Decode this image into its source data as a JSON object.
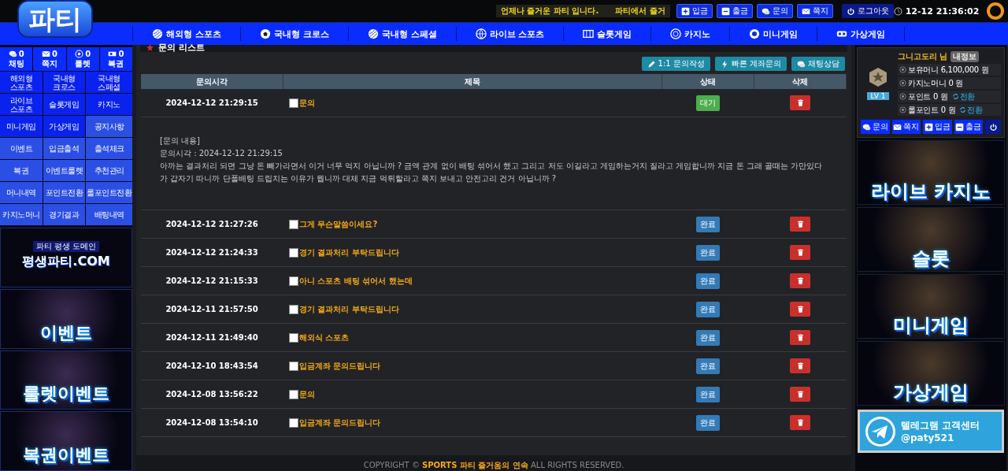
{
  "header": {
    "logo": "파티",
    "marquee": "언제나 즐거운 파티 입니다.      파티에서 즐거",
    "buttons": [
      {
        "label": "입금"
      },
      {
        "label": "출금"
      },
      {
        "label": "문의"
      },
      {
        "label": "쪽지"
      },
      {
        "label": "로그아웃"
      }
    ],
    "clock": "12-12 21:36:02"
  },
  "nav": [
    {
      "label": "해외형 스포츠"
    },
    {
      "label": "국내형 크로스"
    },
    {
      "label": "국내형 스페셜"
    },
    {
      "label": "라이브 스포츠"
    },
    {
      "label": "슬롯게임"
    },
    {
      "label": "카지노"
    },
    {
      "label": "미니게임"
    },
    {
      "label": "가상게임"
    }
  ],
  "sidebar": {
    "counters": [
      {
        "count": "0",
        "label": "채팅"
      },
      {
        "count": "0",
        "label": "쪽지"
      },
      {
        "count": "0",
        "label": "룰렛"
      },
      {
        "count": "0",
        "label": "복권"
      }
    ],
    "menu": [
      {
        "label": "해외형 스포츠",
        "kind": "game"
      },
      {
        "label": "국내형 크로스",
        "kind": "game"
      },
      {
        "label": "국내형 스페셜",
        "kind": "game"
      },
      {
        "label": "라이브 스포츠",
        "kind": "game"
      },
      {
        "label": "슬롯게임",
        "kind": "game"
      },
      {
        "label": "카지노",
        "kind": "game"
      },
      {
        "label": "미니게임",
        "kind": "game"
      },
      {
        "label": "가상게임",
        "kind": "game"
      },
      {
        "label": "공지사항",
        "kind": "info"
      },
      {
        "label": "이벤트",
        "kind": "info"
      },
      {
        "label": "입금출석",
        "kind": "info"
      },
      {
        "label": "출석체크",
        "kind": "info"
      },
      {
        "label": "복권",
        "kind": "info"
      },
      {
        "label": "이벤트룰렛",
        "kind": "info"
      },
      {
        "label": "추천관리",
        "kind": "info"
      },
      {
        "label": "머니내역",
        "kind": "info"
      },
      {
        "label": "포인트전환",
        "kind": "info"
      },
      {
        "label": "롤포인트전환",
        "kind": "info"
      },
      {
        "label": "카지노머니",
        "kind": "info"
      },
      {
        "label": "경기결과",
        "kind": "info"
      },
      {
        "label": "배팅내역",
        "kind": "info"
      }
    ],
    "banners": [
      {
        "kind": "domain",
        "caption": "파티 평생 도메인",
        "title": "평생파티.COM"
      },
      {
        "kind": "promo",
        "title": "이벤트"
      },
      {
        "kind": "promo",
        "title": "룰렛이벤트"
      },
      {
        "kind": "promo",
        "title": "복권이벤트"
      }
    ]
  },
  "main": {
    "title": "문의 리스트",
    "actions": [
      {
        "label": "1:1 문의작성"
      },
      {
        "label": "빠른 계좌문의"
      },
      {
        "label": "채팅상담"
      }
    ],
    "table": {
      "columns": [
        "문의시각",
        "제목",
        "상태",
        "삭제"
      ],
      "rows": [
        {
          "time": "2024-12-12 21:29:15",
          "subject": "문의",
          "checked": false,
          "status": "대기",
          "kind": "waiting",
          "detail": {
            "heading": "[문의 내용]",
            "time_line": "문의시각 : 2024-12-12 21:29:15",
            "body": "아까는 결과처리 되면 그냥 돈 빼가라면서 이거 너무 억지 아닙니까 ? 금액 관계 없이 배팅 섞어서 했고 그리고 저도 이길라고 게임하는거지 질라고 게임합니까 지금 돈 그래 골때는 가만있다가 갑자기 따니까 단폴배팅 드립치는 이유가 뭡니까 대체 지금 먹튀할라고 쪽지 보내고 안전고리 건거 아닙니까 ?"
          }
        },
        {
          "time": "2024-12-12 21:27:26",
          "subject": "그게 무슨말씀이세요?",
          "checked": false,
          "status": "완료",
          "kind": "done"
        },
        {
          "time": "2024-12-12 21:24:33",
          "subject": "경기 결과처리 부탁드립니다",
          "checked": false,
          "status": "완료",
          "kind": "done"
        },
        {
          "time": "2024-12-12 21:15:33",
          "subject": "아니 스포츠 배팅 섞어서 했는데",
          "checked": false,
          "status": "완료",
          "kind": "done"
        },
        {
          "time": "2024-12-11 21:57:50",
          "subject": "경기 결과처리 부탁드립니다",
          "checked": false,
          "status": "완료",
          "kind": "done"
        },
        {
          "time": "2024-12-11 21:49:40",
          "subject": "해외식 스포츠",
          "checked": false,
          "status": "완료",
          "kind": "done"
        },
        {
          "time": "2024-12-10 18:43:54",
          "subject": "입금계좌 문의드립니다",
          "checked": false,
          "status": "완료",
          "kind": "done"
        },
        {
          "time": "2024-12-08 13:56:22",
          "subject": "문의",
          "checked": false,
          "status": "완료",
          "kind": "done"
        },
        {
          "time": "2024-12-08 13:54:10",
          "subject": "입금계좌 문의드립니다",
          "checked": false,
          "status": "완료",
          "kind": "done"
        }
      ]
    },
    "footer": {
      "prefix": "COPYRIGHT © ",
      "brand": "SPORTS 파티 즐거움의 연속",
      "suffix": " ALL RIGHTS RESERVED."
    }
  },
  "user_panel": {
    "name": "그니고도리 님",
    "badge": "내정보",
    "level": "LV 1",
    "balances": [
      {
        "label": "보유머니 6,100,000 원",
        "convert": false
      },
      {
        "label": "카지노머니 0 원",
        "convert": false
      },
      {
        "label": "포인트 0 원",
        "convert": true,
        "convert_label": "전환"
      },
      {
        "label": "롤포인트 0 원",
        "convert": true,
        "convert_label": "전환"
      }
    ],
    "buttons": [
      {
        "label": "문의"
      },
      {
        "label": "쪽지"
      },
      {
        "label": "입금"
      },
      {
        "label": "출금"
      }
    ]
  },
  "right_banners": [
    {
      "kind": "promo",
      "title": "라이브 카지노"
    },
    {
      "kind": "promo",
      "title": "슬롯"
    },
    {
      "kind": "promo",
      "title": "미니게임"
    },
    {
      "kind": "promo",
      "title": "가상게임"
    },
    {
      "kind": "telegram",
      "title": "텔레그램 고객센터",
      "handle": "@paty521"
    }
  ]
}
